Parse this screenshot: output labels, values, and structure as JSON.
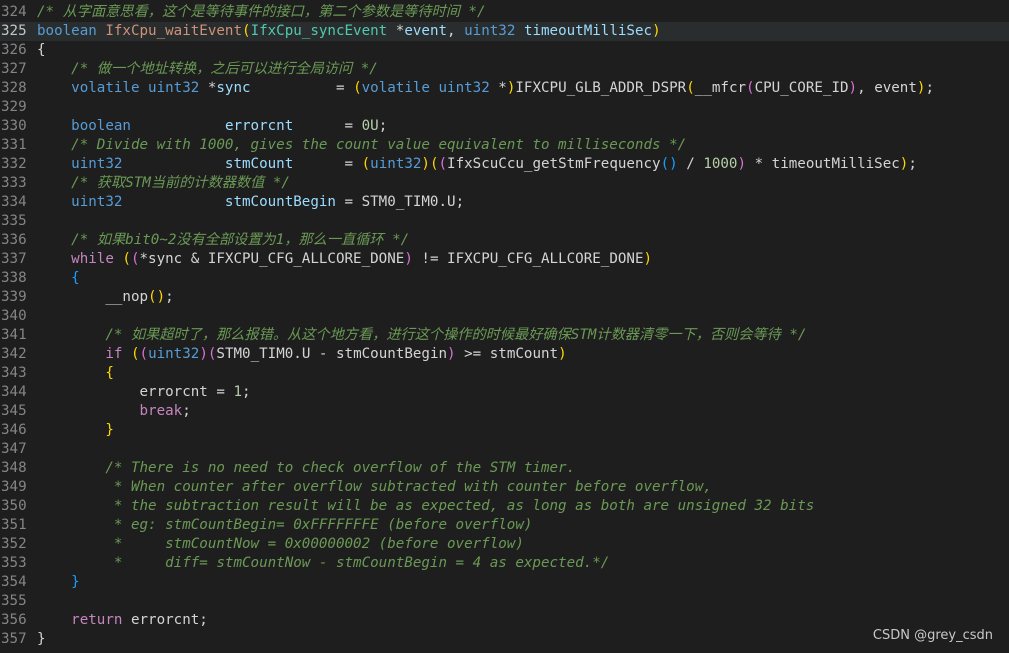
{
  "editor": {
    "lines": [
      {
        "num": "324",
        "tokens": [
          {
            "t": "/* 从字面意思看，这个是等待事件的接口，第二个参数是等待时间 */",
            "c": "cm"
          }
        ]
      },
      {
        "num": "325",
        "current": true,
        "tokens": [
          {
            "t": "boolean",
            "c": "kw"
          },
          {
            "t": " ",
            "c": "pun"
          },
          {
            "t": "IfxCpu_waitEvent",
            "c": "fnh"
          },
          {
            "t": "(",
            "c": "par1"
          },
          {
            "t": "IfxCpu_syncEvent",
            "c": "ty"
          },
          {
            "t": " *",
            "c": "pun"
          },
          {
            "t": "event",
            "c": "var"
          },
          {
            "t": ", ",
            "c": "pun"
          },
          {
            "t": "uint32",
            "c": "kw"
          },
          {
            "t": " ",
            "c": "pun"
          },
          {
            "t": "timeoutMilliSec",
            "c": "var"
          },
          {
            "t": ")",
            "c": "par1"
          }
        ]
      },
      {
        "num": "326",
        "tokens": [
          {
            "t": "{",
            "c": "pun"
          }
        ]
      },
      {
        "num": "327",
        "tokens": [
          {
            "t": "    /* 做一个地址转换，之后可以进行全局访问 */",
            "c": "cm"
          }
        ]
      },
      {
        "num": "328",
        "tokens": [
          {
            "t": "    volatile",
            "c": "kw"
          },
          {
            "t": " ",
            "c": "pun"
          },
          {
            "t": "uint32",
            "c": "kw"
          },
          {
            "t": " *",
            "c": "pun"
          },
          {
            "t": "sync",
            "c": "var"
          },
          {
            "t": "          = ",
            "c": "pun"
          },
          {
            "t": "(",
            "c": "par1"
          },
          {
            "t": "volatile",
            "c": "kw"
          },
          {
            "t": " ",
            "c": "pun"
          },
          {
            "t": "uint32",
            "c": "kw"
          },
          {
            "t": " *",
            "c": "pun"
          },
          {
            "t": ")",
            "c": "par1"
          },
          {
            "t": "IFXCPU_GLB_ADDR_DSPR",
            "c": "mac"
          },
          {
            "t": "(",
            "c": "par1"
          },
          {
            "t": "__mfcr",
            "c": "mac"
          },
          {
            "t": "(",
            "c": "par2"
          },
          {
            "t": "CPU_CORE_ID",
            "c": "mac"
          },
          {
            "t": ")",
            "c": "par2"
          },
          {
            "t": ", ",
            "c": "pun"
          },
          {
            "t": "event",
            "c": "mac"
          },
          {
            "t": ")",
            "c": "par1"
          },
          {
            "t": ";",
            "c": "pun"
          }
        ]
      },
      {
        "num": "329",
        "tokens": []
      },
      {
        "num": "330",
        "tokens": [
          {
            "t": "    boolean",
            "c": "kw"
          },
          {
            "t": "           ",
            "c": "pun"
          },
          {
            "t": "errorcnt",
            "c": "var"
          },
          {
            "t": "      = ",
            "c": "pun"
          },
          {
            "t": "0U",
            "c": "num"
          },
          {
            "t": ";",
            "c": "pun"
          }
        ]
      },
      {
        "num": "331",
        "tokens": [
          {
            "t": "    /* Divide with 1000, gives the count value equivalent to milliseconds */",
            "c": "cm"
          }
        ]
      },
      {
        "num": "332",
        "tokens": [
          {
            "t": "    uint32",
            "c": "kw"
          },
          {
            "t": "            ",
            "c": "pun"
          },
          {
            "t": "stmCount",
            "c": "var"
          },
          {
            "t": "      = ",
            "c": "pun"
          },
          {
            "t": "(",
            "c": "par1"
          },
          {
            "t": "uint32",
            "c": "kw"
          },
          {
            "t": ")",
            "c": "par1"
          },
          {
            "t": "(",
            "c": "par1"
          },
          {
            "t": "(",
            "c": "par2"
          },
          {
            "t": "IfxScuCcu_getStmFrequency",
            "c": "mac"
          },
          {
            "t": "()",
            "c": "par3"
          },
          {
            "t": " / ",
            "c": "pun"
          },
          {
            "t": "1000",
            "c": "num"
          },
          {
            "t": ")",
            "c": "par2"
          },
          {
            "t": " * ",
            "c": "pun"
          },
          {
            "t": "timeoutMilliSec",
            "c": "mac"
          },
          {
            "t": ")",
            "c": "par1"
          },
          {
            "t": ";",
            "c": "pun"
          }
        ]
      },
      {
        "num": "333",
        "tokens": [
          {
            "t": "    /* 获取STM当前的计数器数值 */",
            "c": "cm"
          }
        ]
      },
      {
        "num": "334",
        "tokens": [
          {
            "t": "    uint32",
            "c": "kw"
          },
          {
            "t": "            ",
            "c": "pun"
          },
          {
            "t": "stmCountBegin",
            "c": "var"
          },
          {
            "t": " = ",
            "c": "pun"
          },
          {
            "t": "STM0_TIM0.U",
            "c": "mac"
          },
          {
            "t": ";",
            "c": "pun"
          }
        ]
      },
      {
        "num": "335",
        "tokens": []
      },
      {
        "num": "336",
        "tokens": [
          {
            "t": "    /* 如果bit0~2没有全部设置为1，那么一直循环 */",
            "c": "cm"
          }
        ]
      },
      {
        "num": "337",
        "tokens": [
          {
            "t": "    while",
            "c": "ctl"
          },
          {
            "t": " ",
            "c": "pun"
          },
          {
            "t": "(",
            "c": "par1"
          },
          {
            "t": "(",
            "c": "par2"
          },
          {
            "t": "*sync & IFXCPU_CFG_ALLCORE_DONE",
            "c": "mac"
          },
          {
            "t": ")",
            "c": "par2"
          },
          {
            "t": " != IFXCPU_CFG_ALLCORE_DONE",
            "c": "mac"
          },
          {
            "t": ")",
            "c": "par1"
          }
        ]
      },
      {
        "num": "338",
        "tokens": [
          {
            "t": "    {",
            "c": "par3"
          }
        ]
      },
      {
        "num": "339",
        "tokens": [
          {
            "t": "        __nop",
            "c": "mac"
          },
          {
            "t": "()",
            "c": "par1"
          },
          {
            "t": ";",
            "c": "pun"
          }
        ]
      },
      {
        "num": "340",
        "tokens": []
      },
      {
        "num": "341",
        "tokens": [
          {
            "t": "        /* 如果超时了，那么报错。从这个地方看，进行这个操作的时候最好确保STM计数器清零一下，否则会等待 */",
            "c": "cm"
          }
        ]
      },
      {
        "num": "342",
        "tokens": [
          {
            "t": "        if",
            "c": "ctl"
          },
          {
            "t": " ",
            "c": "pun"
          },
          {
            "t": "(",
            "c": "par1"
          },
          {
            "t": "(",
            "c": "par2"
          },
          {
            "t": "uint32",
            "c": "kw"
          },
          {
            "t": ")",
            "c": "par2"
          },
          {
            "t": "(",
            "c": "par2"
          },
          {
            "t": "STM0_TIM0.U - stmCountBegin",
            "c": "mac"
          },
          {
            "t": ")",
            "c": "par2"
          },
          {
            "t": " >= stmCount",
            "c": "mac"
          },
          {
            "t": ")",
            "c": "par1"
          }
        ]
      },
      {
        "num": "343",
        "tokens": [
          {
            "t": "        {",
            "c": "par1"
          }
        ]
      },
      {
        "num": "344",
        "tokens": [
          {
            "t": "            errorcnt = ",
            "c": "mac"
          },
          {
            "t": "1",
            "c": "num"
          },
          {
            "t": ";",
            "c": "pun"
          }
        ]
      },
      {
        "num": "345",
        "tokens": [
          {
            "t": "            break",
            "c": "ctl"
          },
          {
            "t": ";",
            "c": "pun"
          }
        ]
      },
      {
        "num": "346",
        "tokens": [
          {
            "t": "        }",
            "c": "par1"
          }
        ]
      },
      {
        "num": "347",
        "tokens": []
      },
      {
        "num": "348",
        "tokens": [
          {
            "t": "        /* There is no need to check overflow of the STM timer.",
            "c": "cm"
          }
        ]
      },
      {
        "num": "349",
        "tokens": [
          {
            "t": "         * When counter after overflow subtracted with counter before overflow,",
            "c": "cm"
          }
        ]
      },
      {
        "num": "350",
        "tokens": [
          {
            "t": "         * the subtraction result will be as expected, as long as both are unsigned 32 bits",
            "c": "cm"
          }
        ]
      },
      {
        "num": "351",
        "tokens": [
          {
            "t": "         * eg: stmCountBegin= 0xFFFFFFFE (before overflow)",
            "c": "cm"
          }
        ]
      },
      {
        "num": "352",
        "tokens": [
          {
            "t": "         *     stmCountNow = 0x00000002 (before overflow)",
            "c": "cm"
          }
        ]
      },
      {
        "num": "353",
        "tokens": [
          {
            "t": "         *     diff= stmCountNow - stmCountBegin = 4 as expected.*/",
            "c": "cm"
          }
        ]
      },
      {
        "num": "354",
        "tokens": [
          {
            "t": "    }",
            "c": "par3"
          }
        ]
      },
      {
        "num": "355",
        "tokens": []
      },
      {
        "num": "356",
        "tokens": [
          {
            "t": "    return",
            "c": "ctl"
          },
          {
            "t": " errorcnt;",
            "c": "mac"
          }
        ]
      },
      {
        "num": "357",
        "tokens": [
          {
            "t": "}",
            "c": "pun"
          }
        ]
      }
    ]
  },
  "watermark": "CSDN @grey_csdn"
}
